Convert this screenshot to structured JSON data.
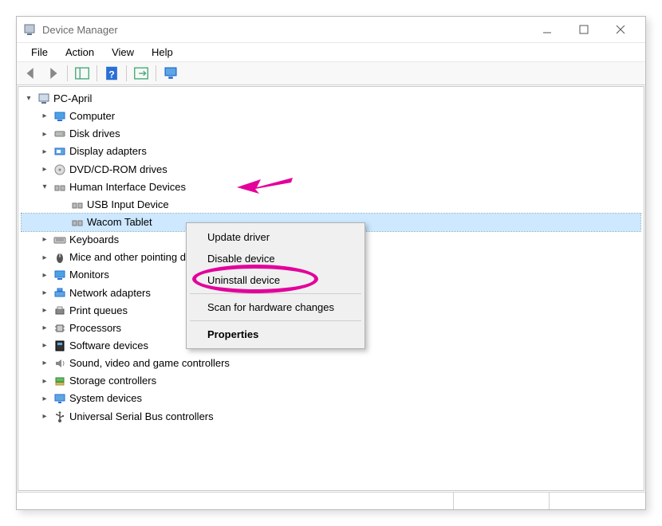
{
  "window": {
    "title": "Device Manager"
  },
  "menu": {
    "file": "File",
    "action": "Action",
    "view": "View",
    "help": "Help"
  },
  "tree": {
    "root": "PC-April",
    "items": [
      {
        "label": "Computer",
        "expanded": false
      },
      {
        "label": "Disk drives",
        "expanded": false
      },
      {
        "label": "Display adapters",
        "expanded": false
      },
      {
        "label": "DVD/CD-ROM drives",
        "expanded": false
      },
      {
        "label": "Human Interface Devices",
        "expanded": true,
        "children": [
          {
            "label": "USB Input Device"
          },
          {
            "label": "Wacom Tablet",
            "selected": true
          }
        ]
      },
      {
        "label": "Keyboards",
        "expanded": false
      },
      {
        "label": "Mice and other pointing devices",
        "expanded": false
      },
      {
        "label": "Monitors",
        "expanded": false
      },
      {
        "label": "Network adapters",
        "expanded": false
      },
      {
        "label": "Print queues",
        "expanded": false
      },
      {
        "label": "Processors",
        "expanded": false
      },
      {
        "label": "Software devices",
        "expanded": false
      },
      {
        "label": "Sound, video and game controllers",
        "expanded": false
      },
      {
        "label": "Storage controllers",
        "expanded": false
      },
      {
        "label": "System devices",
        "expanded": false
      },
      {
        "label": "Universal Serial Bus controllers",
        "expanded": false
      }
    ]
  },
  "context_menu": {
    "update_driver": "Update driver",
    "disable_device": "Disable device",
    "uninstall_device": "Uninstall device",
    "scan_changes": "Scan for hardware changes",
    "properties": "Properties"
  },
  "annotation": {
    "highlight_item": "Uninstall device",
    "arrow_color": "#e3009b"
  }
}
